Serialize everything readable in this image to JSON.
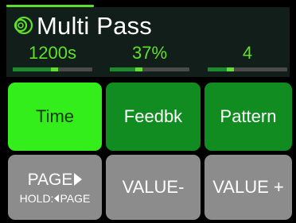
{
  "header": {
    "title": "Multi Pass",
    "logo_icon": "double-ring-icon"
  },
  "params": [
    {
      "value": "1200s",
      "level": 0.53
    },
    {
      "value": "37%",
      "level": 0.37
    },
    {
      "value": "4",
      "level": 0.29
    }
  ],
  "buttons": {
    "time": "Time",
    "feedbk": "Feedbk",
    "pattern": "Pattern",
    "page_label": "PAGE",
    "page_hold_prefix": "HOLD:",
    "page_hold_label": "PAGE",
    "value_minus": "VALUE-",
    "value_plus": "VALUE +"
  },
  "colors": {
    "accent_green": "#5fe02c",
    "selected_button": "#33ee1b",
    "button_green": "#108c20",
    "button_gray": "#8c8c8c",
    "header_bg": "#111e1a"
  }
}
